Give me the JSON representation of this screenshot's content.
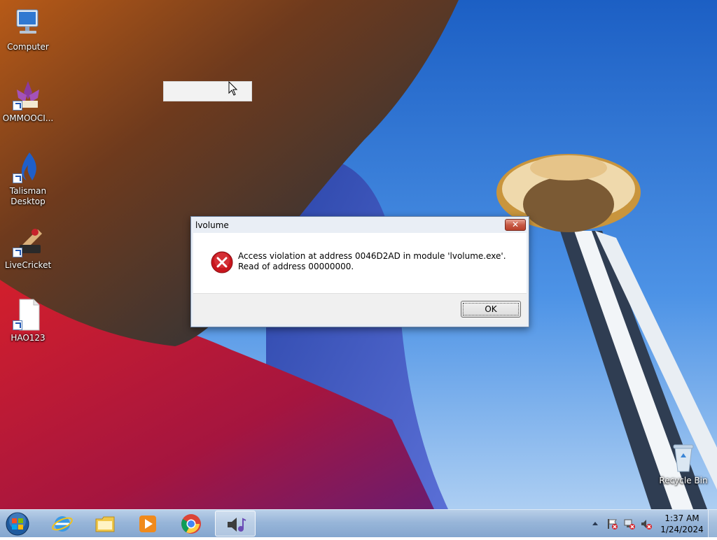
{
  "desktop": {
    "icons": [
      {
        "label": "Computer"
      },
      {
        "label": "OMMOOCI..."
      },
      {
        "label": "Talisman Desktop"
      },
      {
        "label": "LiveCricket"
      },
      {
        "label": "HAO123"
      },
      {
        "label": "Recycle Bin"
      }
    ]
  },
  "dialog": {
    "title": "lvolume",
    "close_label": "✕",
    "icon": "error-icon",
    "message": "Access violation at address 0046D2AD in module 'lvolume.exe'. Read of address 00000000.",
    "ok_label": "OK"
  },
  "taskbar": {
    "pinned": [
      "start-orb-icon",
      "internet-explorer-icon",
      "file-explorer-icon",
      "media-player-icon",
      "chrome-icon",
      "lvolume-app-icon"
    ],
    "active_item": "lvolume-app-icon"
  },
  "tray": {
    "time": "1:37 AM",
    "date": "1/24/2024"
  },
  "colors": {
    "error_red": "#c8161d",
    "taskbar_blue": "#98b6d9",
    "sky_blue": "#2d7ed8"
  }
}
